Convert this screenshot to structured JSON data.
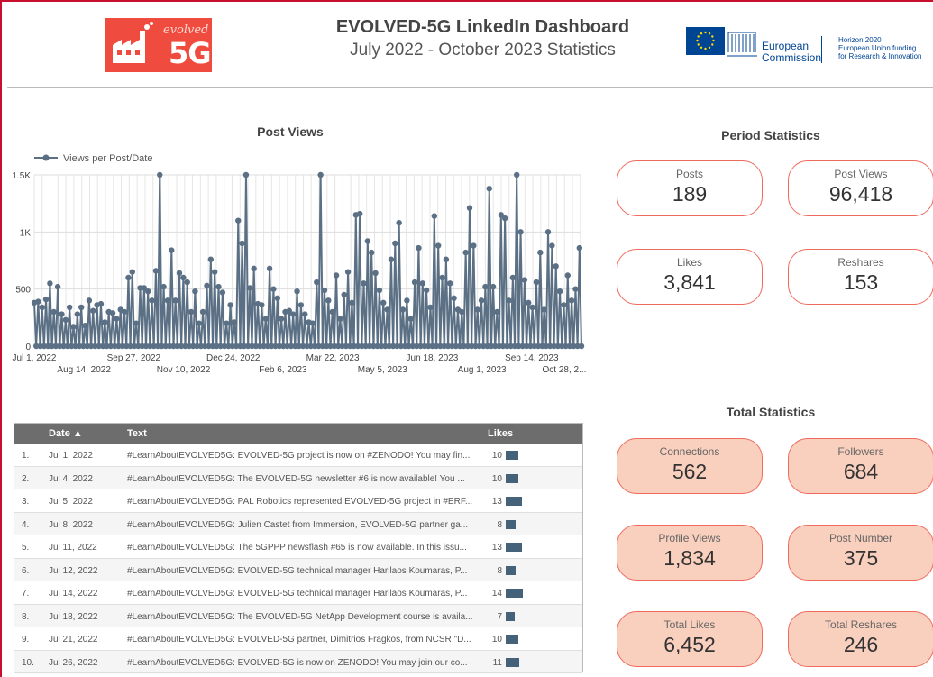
{
  "header": {
    "title": "EVOLVED-5G LinkedIn Dashboard",
    "subtitle": "July 2022 - October 2023 Statistics",
    "logo_word": "evolved",
    "logo_5g": "5G",
    "ec_text_line1": "European",
    "ec_text_line2": "Commission",
    "h2020_line1": "Horizon 2020",
    "h2020_line2": "European Union funding",
    "h2020_line3": "for Research & Innovation"
  },
  "chart": {
    "title": "Post Views",
    "legend": "Views per Post/Date",
    "color": "#5b7085"
  },
  "chart_data": {
    "type": "line",
    "title": "Post Views",
    "series": [
      {
        "name": "Views per Post/Date"
      }
    ],
    "ylim": [
      0,
      1500
    ],
    "yticks": [
      {
        "label": "0",
        "v": 0
      },
      {
        "label": "500",
        "v": 500
      },
      {
        "label": "1K",
        "v": 1000
      },
      {
        "label": "1.5K",
        "v": 1500
      }
    ],
    "xlim": [
      0,
      484
    ],
    "xticks_top": [
      {
        "label": "Jul 1, 2022",
        "d": 0
      },
      {
        "label": "Sep 27, 2022",
        "d": 88
      },
      {
        "label": "Dec 24, 2022",
        "d": 176
      },
      {
        "label": "Mar 22, 2023",
        "d": 264
      },
      {
        "label": "Jun 18, 2023",
        "d": 352
      },
      {
        "label": "Sep 14, 2023",
        "d": 440
      }
    ],
    "xticks_bottom": [
      {
        "label": "Aug 14, 2022",
        "d": 44
      },
      {
        "label": "Nov 10, 2022",
        "d": 132
      },
      {
        "label": "Feb 6, 2023",
        "d": 220
      },
      {
        "label": "May 5, 2023",
        "d": 308
      },
      {
        "label": "Aug 1, 2023",
        "d": 396
      },
      {
        "label": "Oct 28, 2...",
        "d": 484
      }
    ],
    "points": [
      [
        0,
        380
      ],
      [
        1,
        0
      ],
      [
        2,
        390
      ],
      [
        3,
        0
      ],
      [
        4,
        340
      ],
      [
        5,
        0
      ],
      [
        6,
        410
      ],
      [
        7,
        0
      ],
      [
        8,
        550
      ],
      [
        9,
        0
      ],
      [
        10,
        300
      ],
      [
        11,
        0
      ],
      [
        12,
        520
      ],
      [
        13,
        0
      ],
      [
        14,
        280
      ],
      [
        15,
        0
      ],
      [
        16,
        230
      ],
      [
        17,
        0
      ],
      [
        18,
        340
      ],
      [
        19,
        0
      ],
      [
        20,
        170
      ],
      [
        21,
        0
      ],
      [
        22,
        280
      ],
      [
        23,
        0
      ],
      [
        24,
        340
      ],
      [
        25,
        0
      ],
      [
        26,
        180
      ],
      [
        27,
        0
      ],
      [
        28,
        400
      ],
      [
        29,
        0
      ],
      [
        30,
        310
      ],
      [
        31,
        0
      ],
      [
        32,
        360
      ],
      [
        33,
        0
      ],
      [
        34,
        370
      ],
      [
        35,
        0
      ],
      [
        36,
        210
      ],
      [
        37,
        0
      ],
      [
        38,
        300
      ],
      [
        39,
        0
      ],
      [
        40,
        290
      ],
      [
        41,
        0
      ],
      [
        42,
        240
      ],
      [
        43,
        0
      ],
      [
        44,
        320
      ],
      [
        45,
        0
      ],
      [
        46,
        300
      ],
      [
        47,
        0
      ],
      [
        48,
        600
      ],
      [
        49,
        0
      ],
      [
        50,
        650
      ],
      [
        51,
        0
      ],
      [
        52,
        200
      ],
      [
        53,
        0
      ],
      [
        54,
        510
      ],
      [
        55,
        0
      ],
      [
        56,
        510
      ],
      [
        57,
        0
      ],
      [
        58,
        480
      ],
      [
        59,
        0
      ],
      [
        60,
        400
      ],
      [
        61,
        0
      ],
      [
        62,
        660
      ],
      [
        63,
        0
      ],
      [
        64,
        1500
      ],
      [
        65,
        0
      ],
      [
        66,
        520
      ],
      [
        67,
        0
      ],
      [
        68,
        400
      ],
      [
        69,
        0
      ],
      [
        70,
        840
      ],
      [
        71,
        0
      ],
      [
        72,
        400
      ],
      [
        73,
        0
      ],
      [
        74,
        640
      ],
      [
        75,
        0
      ],
      [
        76,
        600
      ],
      [
        77,
        0
      ],
      [
        78,
        560
      ],
      [
        79,
        0
      ],
      [
        80,
        300
      ],
      [
        81,
        0
      ],
      [
        82,
        480
      ],
      [
        83,
        0
      ],
      [
        84,
        200
      ],
      [
        85,
        0
      ],
      [
        86,
        300
      ],
      [
        87,
        0
      ],
      [
        88,
        530
      ],
      [
        89,
        0
      ],
      [
        90,
        760
      ],
      [
        91,
        0
      ],
      [
        92,
        650
      ],
      [
        93,
        0
      ],
      [
        94,
        520
      ],
      [
        95,
        0
      ],
      [
        96,
        470
      ],
      [
        97,
        0
      ],
      [
        98,
        200
      ],
      [
        99,
        0
      ],
      [
        100,
        360
      ],
      [
        101,
        0
      ],
      [
        102,
        210
      ],
      [
        103,
        0
      ],
      [
        104,
        1100
      ],
      [
        105,
        0
      ],
      [
        106,
        900
      ],
      [
        107,
        0
      ],
      [
        108,
        1500
      ],
      [
        109,
        0
      ],
      [
        110,
        510
      ],
      [
        111,
        0
      ],
      [
        112,
        680
      ],
      [
        113,
        0
      ],
      [
        114,
        370
      ],
      [
        115,
        0
      ],
      [
        116,
        360
      ],
      [
        117,
        0
      ],
      [
        118,
        240
      ],
      [
        119,
        0
      ],
      [
        120,
        680
      ],
      [
        121,
        0
      ],
      [
        122,
        500
      ],
      [
        123,
        0
      ],
      [
        124,
        420
      ],
      [
        125,
        0
      ],
      [
        126,
        240
      ],
      [
        127,
        0
      ],
      [
        128,
        300
      ],
      [
        129,
        0
      ],
      [
        130,
        310
      ],
      [
        131,
        0
      ],
      [
        132,
        280
      ],
      [
        133,
        0
      ],
      [
        134,
        480
      ],
      [
        135,
        0
      ],
      [
        136,
        360
      ],
      [
        137,
        0
      ],
      [
        138,
        280
      ],
      [
        139,
        0
      ],
      [
        140,
        210
      ],
      [
        141,
        0
      ],
      [
        142,
        200
      ],
      [
        143,
        0
      ],
      [
        144,
        560
      ],
      [
        145,
        0
      ],
      [
        146,
        1500
      ],
      [
        147,
        0
      ],
      [
        148,
        490
      ],
      [
        149,
        0
      ],
      [
        150,
        400
      ],
      [
        151,
        0
      ],
      [
        152,
        300
      ],
      [
        153,
        0
      ],
      [
        154,
        620
      ],
      [
        155,
        0
      ],
      [
        156,
        240
      ],
      [
        157,
        0
      ],
      [
        158,
        450
      ],
      [
        159,
        0
      ],
      [
        160,
        650
      ],
      [
        161,
        0
      ],
      [
        162,
        380
      ],
      [
        163,
        0
      ],
      [
        164,
        1150
      ],
      [
        165,
        0
      ],
      [
        166,
        1160
      ],
      [
        167,
        0
      ],
      [
        168,
        550
      ],
      [
        169,
        0
      ],
      [
        170,
        920
      ],
      [
        171,
        0
      ],
      [
        172,
        820
      ],
      [
        173,
        0
      ],
      [
        174,
        640
      ],
      [
        175,
        0
      ],
      [
        176,
        490
      ],
      [
        177,
        0
      ],
      [
        178,
        380
      ],
      [
        179,
        0
      ],
      [
        180,
        320
      ],
      [
        181,
        0
      ],
      [
        182,
        760
      ],
      [
        183,
        0
      ],
      [
        184,
        900
      ],
      [
        185,
        0
      ],
      [
        186,
        1080
      ],
      [
        187,
        0
      ],
      [
        188,
        320
      ],
      [
        189,
        0
      ],
      [
        190,
        400
      ],
      [
        191,
        0
      ],
      [
        192,
        240
      ],
      [
        193,
        0
      ],
      [
        194,
        560
      ],
      [
        195,
        0
      ],
      [
        196,
        860
      ],
      [
        197,
        0
      ],
      [
        198,
        550
      ],
      [
        199,
        0
      ],
      [
        200,
        490
      ],
      [
        201,
        0
      ],
      [
        202,
        340
      ],
      [
        203,
        0
      ],
      [
        204,
        1140
      ],
      [
        205,
        0
      ],
      [
        206,
        880
      ],
      [
        207,
        0
      ],
      [
        208,
        600
      ],
      [
        209,
        0
      ],
      [
        210,
        760
      ],
      [
        211,
        0
      ],
      [
        212,
        550
      ],
      [
        213,
        0
      ],
      [
        214,
        420
      ],
      [
        215,
        0
      ],
      [
        216,
        320
      ],
      [
        217,
        0
      ],
      [
        218,
        300
      ],
      [
        219,
        0
      ],
      [
        220,
        820
      ],
      [
        221,
        0
      ],
      [
        222,
        1210
      ],
      [
        223,
        0
      ],
      [
        224,
        880
      ],
      [
        225,
        0
      ],
      [
        226,
        320
      ],
      [
        227,
        0
      ],
      [
        228,
        400
      ],
      [
        229,
        0
      ],
      [
        230,
        520
      ],
      [
        231,
        0
      ],
      [
        232,
        1380
      ],
      [
        233,
        0
      ],
      [
        234,
        520
      ],
      [
        235,
        0
      ],
      [
        236,
        300
      ],
      [
        237,
        0
      ],
      [
        238,
        1150
      ],
      [
        239,
        0
      ],
      [
        240,
        1120
      ],
      [
        241,
        0
      ],
      [
        242,
        400
      ],
      [
        243,
        0
      ],
      [
        244,
        600
      ],
      [
        245,
        0
      ],
      [
        246,
        1500
      ],
      [
        247,
        0
      ],
      [
        248,
        1000
      ],
      [
        249,
        0
      ],
      [
        250,
        580
      ],
      [
        251,
        0
      ],
      [
        252,
        380
      ],
      [
        253,
        0
      ],
      [
        254,
        340
      ],
      [
        255,
        0
      ],
      [
        256,
        560
      ],
      [
        257,
        0
      ],
      [
        258,
        820
      ],
      [
        259,
        0
      ],
      [
        260,
        320
      ],
      [
        261,
        0
      ],
      [
        262,
        1000
      ],
      [
        263,
        0
      ],
      [
        264,
        880
      ],
      [
        265,
        0
      ],
      [
        266,
        700
      ],
      [
        267,
        0
      ],
      [
        268,
        480
      ],
      [
        269,
        0
      ],
      [
        270,
        360
      ],
      [
        271,
        0
      ],
      [
        272,
        620
      ],
      [
        273,
        0
      ],
      [
        274,
        400
      ],
      [
        275,
        0
      ],
      [
        276,
        500
      ],
      [
        277,
        0
      ],
      [
        278,
        860
      ],
      [
        279,
        0
      ]
    ]
  },
  "table": {
    "headers": {
      "date": "Date ▲",
      "text": "Text",
      "likes": "Likes"
    },
    "max_likes": 14,
    "rows": [
      {
        "idx": "1.",
        "date": "Jul 1, 2022",
        "text": "#LearnAboutEVOLVED5G: EVOLVED-5G project is now on #ZENODO! You may fin...",
        "likes": 10
      },
      {
        "idx": "2.",
        "date": "Jul 4, 2022",
        "text": "#LearnAboutEVOLVED5G: The EVOLVED-5G newsletter #6 is now available! You ...",
        "likes": 10
      },
      {
        "idx": "3.",
        "date": "Jul 5, 2022",
        "text": "#LearnAboutEVOLVED5G: PAL Robotics represented EVOLVED-5G project in #ERF...",
        "likes": 13
      },
      {
        "idx": "4.",
        "date": "Jul 8, 2022",
        "text": "#LearnAboutEVOLVED5G: Julien Castet from Immersion, EVOLVED-5G partner ga...",
        "likes": 8
      },
      {
        "idx": "5.",
        "date": "Jul 11, 2022",
        "text": "#LearnAboutEVOLVED5G: The 5GPPP newsflash #65 is now available. In this issu...",
        "likes": 13
      },
      {
        "idx": "6.",
        "date": "Jul 12, 2022",
        "text": "#LearnAboutEVOLVED5G: EVOLVED-5G technical manager Harilaos Koumaras, P...",
        "likes": 8
      },
      {
        "idx": "7.",
        "date": "Jul 14, 2022",
        "text": "#LearnAboutEVOLVED5G: EVOLVED-5G technical manager Harilaos Koumaras, P...",
        "likes": 14
      },
      {
        "idx": "8.",
        "date": "Jul 18, 2022",
        "text": "#LearnAboutEVOLVED5G: The EVOLVED-5G NetApp Development course is availa...",
        "likes": 7
      },
      {
        "idx": "9.",
        "date": "Jul 21, 2022",
        "text": "#LearnAboutEVOLVED5G: EVOLVED-5G partner, Dimitrios Fragkos, from NCSR \"D...",
        "likes": 10
      },
      {
        "idx": "10.",
        "date": "Jul 26, 2022",
        "text": "#LearnAboutEVOLVED5G: EVOLVED-5G is now on ZENODO! You may join our co...",
        "likes": 11
      }
    ]
  },
  "period": {
    "title": "Period Statistics",
    "posts_label": "Posts",
    "posts_value": "189",
    "views_label": "Post Views",
    "views_value": "96,418",
    "likes_label": "Likes",
    "likes_value": "3,841",
    "reshares_label": "Reshares",
    "reshares_value": "153"
  },
  "total": {
    "title": "Total Statistics",
    "connections_label": "Connections",
    "connections_value": "562",
    "followers_label": "Followers",
    "followers_value": "684",
    "profile_views_label": "Profile Views",
    "profile_views_value": "1,834",
    "post_number_label": "Post Number",
    "post_number_value": "375",
    "total_likes_label": "Total Likes",
    "total_likes_value": "6,452",
    "total_reshares_label": "Total Reshares",
    "total_reshares_value": "246"
  }
}
